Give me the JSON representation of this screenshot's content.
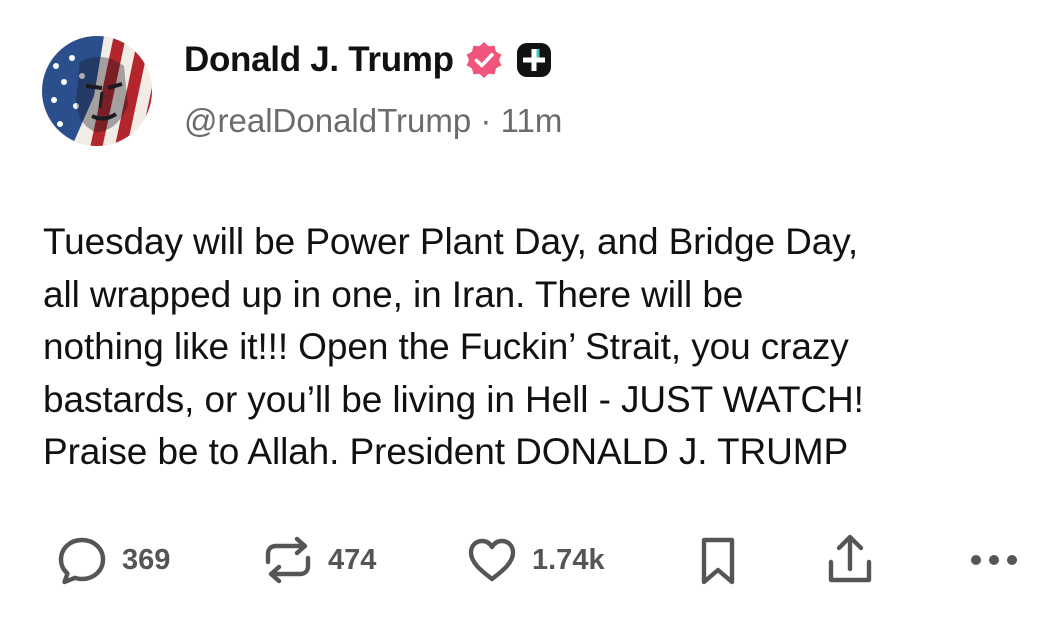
{
  "author": {
    "display_name": "Donald J. Trump",
    "handle": "@realDonaldTrump",
    "separator": "·",
    "time_ago": "11m",
    "avatar_icon": "user-avatar-flag-portrait",
    "verified_badge_icon": "verified-badge-icon",
    "verified_color": "#f0557a",
    "plus_badge_icon": "plus-badge-icon"
  },
  "post": {
    "lines": [
      "Tuesday will be Power Plant Day, and Bridge Day,",
      "all wrapped up in one, in Iran. There will be",
      "nothing like it!!! Open the Fuckin’ Strait, you crazy",
      "bastards, or you’ll be living in Hell - JUST WATCH!",
      "Praise be to Allah. President DONALD J. TRUMP"
    ]
  },
  "actions": {
    "reply": {
      "icon": "comment-icon",
      "count": "369"
    },
    "repost": {
      "icon": "repost-icon",
      "count": "474"
    },
    "like": {
      "icon": "heart-icon",
      "count": "1.74k"
    },
    "bookmark": {
      "icon": "bookmark-icon"
    },
    "share": {
      "icon": "share-icon"
    },
    "more": {
      "icon": "more-dots-icon"
    }
  }
}
